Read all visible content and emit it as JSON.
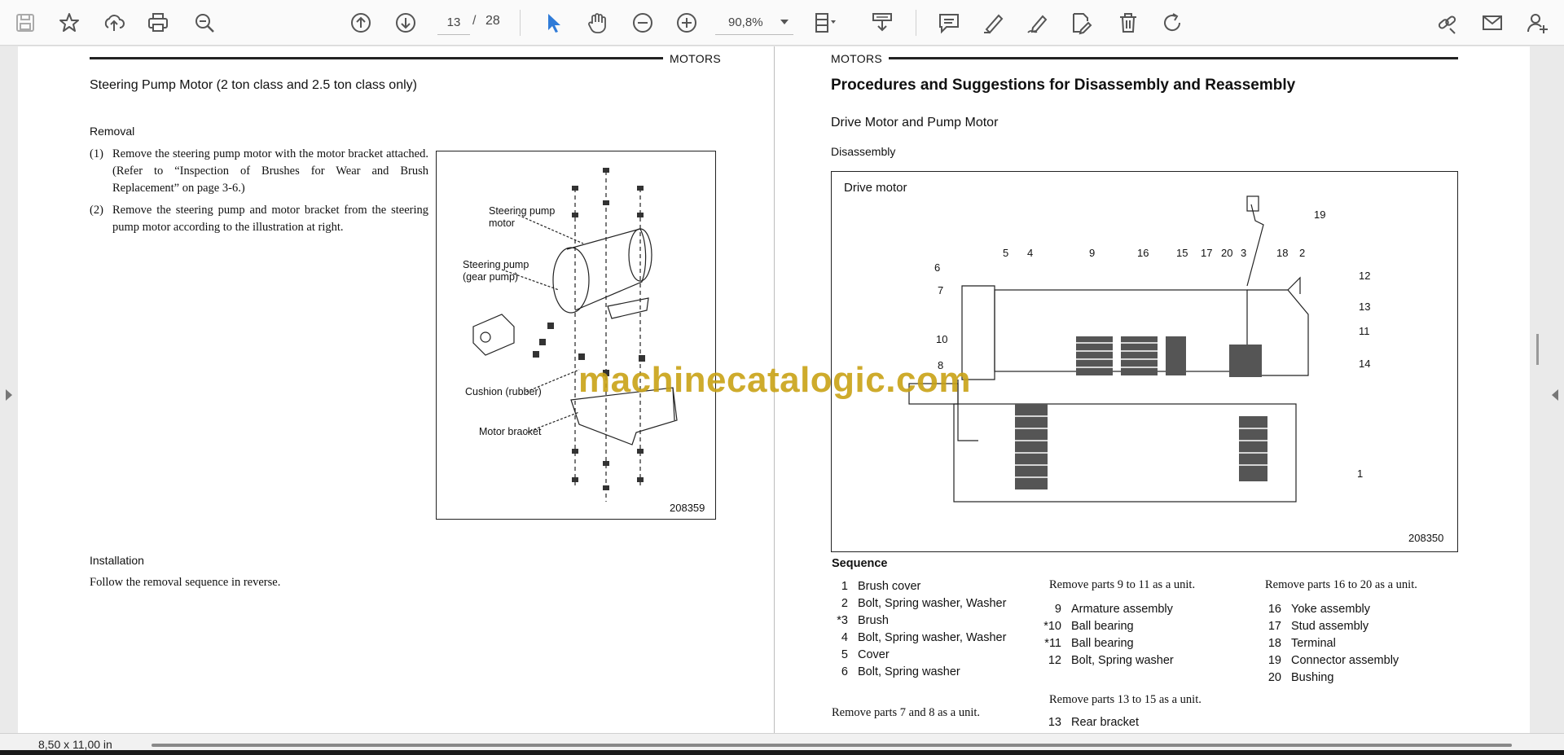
{
  "toolbar": {
    "page_current": "13",
    "page_separator": "/",
    "page_total": "28",
    "zoom": "90,8%",
    "icons": [
      "save-icon",
      "bookmark-star-icon",
      "upload-cloud-icon",
      "print-icon",
      "zoom-search-icon",
      "page-up-icon",
      "page-down-icon",
      "select-cursor-icon",
      "hand-icon",
      "zoom-out-icon",
      "zoom-in-icon",
      "page-fit-icon",
      "download-icon",
      "comment-icon",
      "highlight-icon",
      "sign-icon",
      "edit-pdf-icon",
      "delete-icon",
      "rotate-icon",
      "link-icon",
      "mail-icon",
      "user-add-icon"
    ],
    "accent_color": "#2f7bd8"
  },
  "left_page": {
    "header": "MOTORS",
    "section_title": "Steering Pump Motor (2 ton class and 2.5 ton class only)",
    "removal_heading": "Removal",
    "steps": [
      {
        "num": "(1)",
        "text": "Remove the steering pump motor with the motor bracket attached. (Refer to “Inspection of Brushes for Wear and Brush Replacement” on page 3-6.)"
      },
      {
        "num": "(2)",
        "text": "Remove the steering pump and motor bracket from the steering pump motor according to the illustration at right."
      }
    ],
    "installation_heading": "Installation",
    "installation_text": "Follow the removal sequence in reverse.",
    "figure": {
      "labels": {
        "steering_pump_motor": "Steering pump motor",
        "steering_pump": "Steering pump (gear pump)",
        "cushion": "Cushion (rubber)",
        "motor_bracket": "Motor bracket"
      },
      "code": "208359"
    }
  },
  "right_page": {
    "header": "MOTORS",
    "title": "Procedures and Suggestions for Disassembly and Reassembly",
    "subtitle": "Drive Motor and Pump Motor",
    "disassembly": "Disassembly",
    "figure": {
      "caption": "Drive motor",
      "code": "208350",
      "callouts": [
        "5",
        "4",
        "9",
        "16",
        "15",
        "17",
        "20",
        "3",
        "18",
        "2",
        "19",
        "6",
        "7",
        "10",
        "8",
        "12",
        "13",
        "11",
        "14",
        "1"
      ]
    },
    "sequence_title": "Sequence",
    "col1": [
      {
        "n": "1",
        "label": "Brush cover"
      },
      {
        "n": "2",
        "label": "Bolt, Spring washer, Washer"
      },
      {
        "n": "*3",
        "label": "Brush"
      },
      {
        "n": "4",
        "label": "Bolt, Spring washer, Washer"
      },
      {
        "n": "5",
        "label": "Cover"
      },
      {
        "n": "6",
        "label": "Bolt, Spring washer"
      }
    ],
    "note_7_8": "Remove parts 7 and 8 as a unit.",
    "col2_note": "Remove parts 9 to 11 as a unit.",
    "col2": [
      {
        "n": "9",
        "label": "Armature assembly"
      },
      {
        "n": "*10",
        "label": "Ball bearing"
      },
      {
        "n": "*11",
        "label": "Ball bearing"
      },
      {
        "n": "12",
        "label": "Bolt, Spring washer"
      }
    ],
    "note_13_15": "Remove parts 13 to 15 as a unit.",
    "col2b": [
      {
        "n": "13",
        "label": "Rear bracket"
      }
    ],
    "col3_note": "Remove parts 16 to 20 as a unit.",
    "col3": [
      {
        "n": "16",
        "label": "Yoke assembly"
      },
      {
        "n": "17",
        "label": "Stud assembly"
      },
      {
        "n": "18",
        "label": "Terminal"
      },
      {
        "n": "19",
        "label": "Connector assembly"
      },
      {
        "n": "20",
        "label": "Bushing"
      }
    ]
  },
  "watermark": "machinecatalogic.com",
  "status": {
    "page_size": "8,50 x 11,00 in"
  }
}
